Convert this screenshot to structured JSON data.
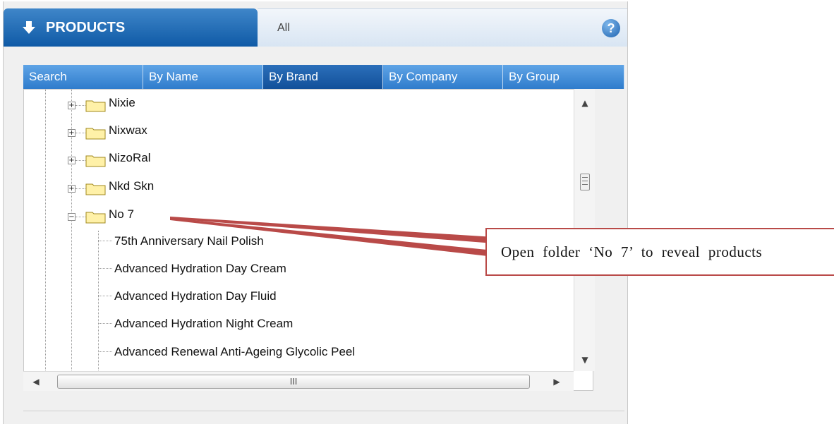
{
  "header": {
    "products_label": "PRODUCTS",
    "filter_value": "All",
    "help_symbol": "?"
  },
  "tabs": [
    {
      "label": "Search",
      "active": false
    },
    {
      "label": "By Name",
      "active": false
    },
    {
      "label": "By Brand",
      "active": true
    },
    {
      "label": "By Company",
      "active": false
    },
    {
      "label": "By Group",
      "active": false
    }
  ],
  "tree": {
    "folders": [
      "Nixie",
      "Nixwax",
      "NizoRal",
      "Nkd Skn",
      "No 7"
    ],
    "open_folder": "No 7",
    "products": [
      "75th Anniversary Nail Polish",
      "Advanced Hydration Day Cream",
      "Advanced Hydration Day Fluid",
      "Advanced Hydration Night Cream",
      "Advanced Renewal Anti-Ageing Glycolic Peel"
    ]
  },
  "scrollbars": {
    "vertical_up": "▲",
    "vertical_down": "▼",
    "horizontal_left": "◀",
    "horizontal_right": "▶",
    "horizontal_grip": "III"
  },
  "callout": {
    "text": "Open folder ‘No 7’ to reveal products"
  },
  "colors": {
    "header_blue": "#1a63b0",
    "tab_blue": "#4a93dc",
    "tab_active": "#1a5ca6",
    "callout_red": "#b94a48"
  },
  "icons": {
    "products": "arrow-down-icon",
    "help": "help-icon",
    "folder": "folder-icon"
  }
}
